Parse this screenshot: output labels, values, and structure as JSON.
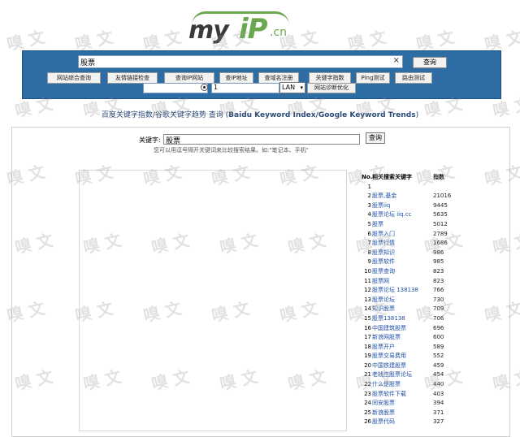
{
  "logo": {
    "text_a": "my",
    "text_b": "iP",
    "text_c": ".cn"
  },
  "search": {
    "query": "股票",
    "clear": "×",
    "submit": "查询",
    "tools": [
      "网站综合查询",
      "友情链接检查",
      "查询IP网站",
      "查IP地址",
      "查域名注册",
      "关键字指数",
      "Ping测试",
      "路由测试"
    ],
    "ip_value": "",
    "num_value": "1",
    "lan_option": "LAN",
    "diagnose": "网站诊断优化"
  },
  "subtitle": {
    "part1": "百度关键字指数",
    "part2": "/谷歌关键字趋势 查询 (",
    "part3": "Baidu Keyword Index/Google Keyword Trends",
    "part4": ")"
  },
  "keyword_form": {
    "label": "关键字:",
    "value": "股票",
    "submit": "查询",
    "hint": "您可以用逗号隔开关键词来比较搜索结果。如:\"笔记本、手机\""
  },
  "ranking": {
    "headers": [
      "No.",
      "相关搜索关键字",
      "指数"
    ],
    "rows": [
      {
        "no": "1",
        "kw": "",
        "ix": ""
      },
      {
        "no": "2",
        "kw": "股票,基金",
        "ix": "21016"
      },
      {
        "no": "3",
        "kw": "股票iiq",
        "ix": "9445"
      },
      {
        "no": "4",
        "kw": "股票论坛 iiq.cc",
        "ix": "5635"
      },
      {
        "no": "5",
        "kw": "股票",
        "ix": "5012"
      },
      {
        "no": "6",
        "kw": "股票入门",
        "ix": "2789"
      },
      {
        "no": "7",
        "kw": "股票行情",
        "ix": "1686"
      },
      {
        "no": "8",
        "kw": "股票知识",
        "ix": "986"
      },
      {
        "no": "9",
        "kw": "股票软件",
        "ix": "985"
      },
      {
        "no": "10",
        "kw": "股票查询",
        "ix": "823"
      },
      {
        "no": "11",
        "kw": "股票网",
        "ix": "823"
      },
      {
        "no": "12",
        "kw": "股票论坛 138138",
        "ix": "766"
      },
      {
        "no": "13",
        "kw": "股票论坛",
        "ix": "730"
      },
      {
        "no": "14",
        "kw": "知识股票",
        "ix": "709"
      },
      {
        "no": "15",
        "kw": "股票138138",
        "ix": "706"
      },
      {
        "no": "16",
        "kw": "中国建筑股票",
        "ix": "696"
      },
      {
        "no": "17",
        "kw": "新浪网股票",
        "ix": "600"
      },
      {
        "no": "18",
        "kw": "股票开户",
        "ix": "589"
      },
      {
        "no": "19",
        "kw": "股票交易费用",
        "ix": "552"
      },
      {
        "no": "20",
        "kw": "中国铁建股票",
        "ix": "459"
      },
      {
        "no": "21",
        "kw": "老钱庄股票论坛",
        "ix": "454"
      },
      {
        "no": "22",
        "kw": "什么是股票",
        "ix": "440"
      },
      {
        "no": "23",
        "kw": "股票软件下载",
        "ix": "403"
      },
      {
        "no": "24",
        "kw": "同安股票",
        "ix": "394"
      },
      {
        "no": "25",
        "kw": "新浪股票",
        "ix": "371"
      },
      {
        "no": "26",
        "kw": "股票代码",
        "ix": "327"
      }
    ]
  },
  "watermark": "嗅 文"
}
